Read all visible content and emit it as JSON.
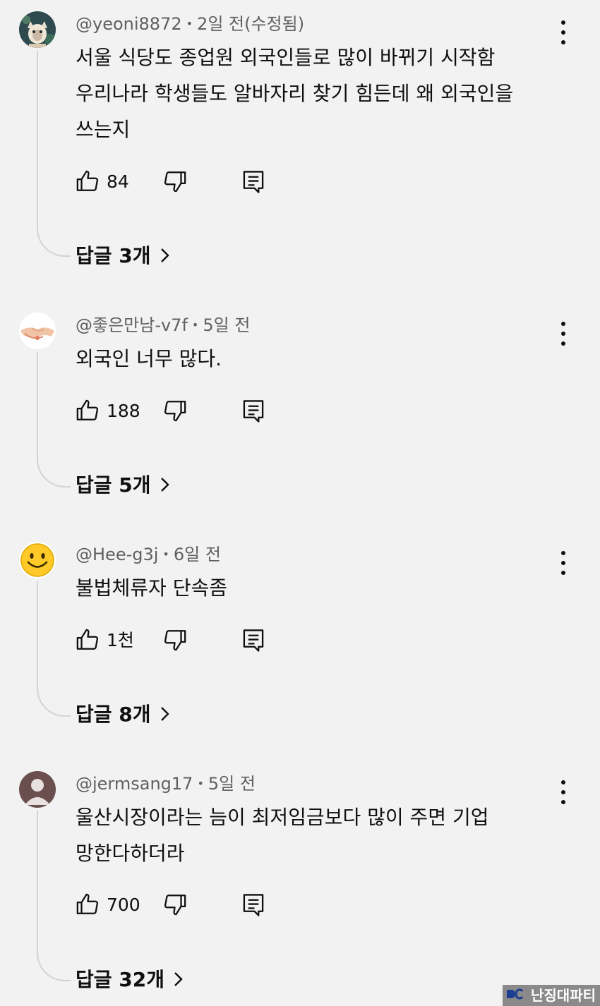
{
  "comments": [
    {
      "author": "@yeoni8872",
      "time": "2일 전(수정됨)",
      "text": "서울 식당도 종업원 외국인들로 많이 바뀌기 시작함\n우리나라 학생들도 알바자리 찾기 힘든데 왜 외국인을\n쓰는지",
      "likes": "84",
      "replies": "답글 3개",
      "avatar": "cat-avatar"
    },
    {
      "author": "@좋은만남-v7f",
      "time": "5일 전",
      "text": "외국인 너무 많다.",
      "likes": "188",
      "replies": "답글 5개",
      "avatar": "handshake-avatar"
    },
    {
      "author": "@Hee-g3j",
      "time": "6일 전",
      "text": "불법체류자 단속좀",
      "likes": "1천",
      "replies": "답글 8개",
      "avatar": "smiley-avatar"
    },
    {
      "author": "@jermsang17",
      "time": "5일 전",
      "text": "울산시장이라는 늠이 최저임금보다 많이 주면 기업\n망한다하더라",
      "likes": "700",
      "replies": "답글 32개",
      "avatar": "default-person-avatar"
    }
  ],
  "watermark": {
    "text": "난징대파티"
  },
  "colors": {
    "background": "#f2f2f2",
    "text": "#0f0f0f",
    "secondary": "#606060",
    "thread": "#d3d3d3"
  },
  "icons": [
    "thumbs-up-icon",
    "thumbs-down-icon",
    "reply-icon",
    "more-vertical-icon",
    "chevron-right-icon"
  ]
}
